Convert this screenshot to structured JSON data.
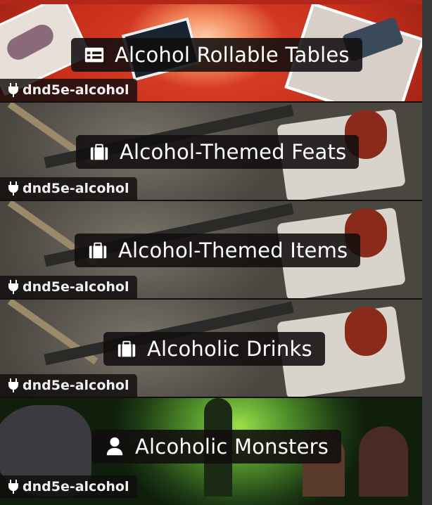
{
  "entries": [
    {
      "title": "Alcohol Rollable Tables",
      "icon": "table-list-icon",
      "source": "dnd5e-alcohol",
      "theme_color": "#c8301c"
    },
    {
      "title": "Alcohol-Themed Feats",
      "icon": "suitcase-icon",
      "source": "dnd5e-alcohol",
      "theme_color": "#5c5750"
    },
    {
      "title": "Alcohol-Themed Items",
      "icon": "suitcase-icon",
      "source": "dnd5e-alcohol",
      "theme_color": "#5c5750"
    },
    {
      "title": "Alcoholic Drinks",
      "icon": "suitcase-icon",
      "source": "dnd5e-alcohol",
      "theme_color": "#5c5750"
    },
    {
      "title": "Alcoholic Monsters",
      "icon": "user-icon",
      "source": "dnd5e-alcohol",
      "theme_color": "#4f8d2a"
    }
  ],
  "source_icon": "plug-icon"
}
